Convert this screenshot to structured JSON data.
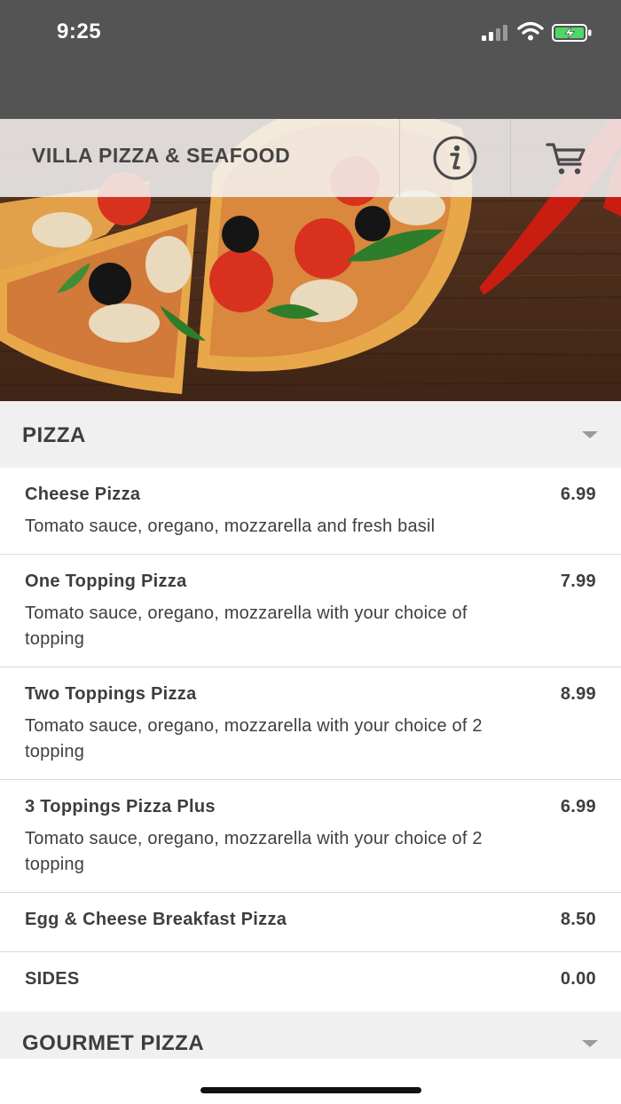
{
  "status_bar": {
    "time": "9:25",
    "icons": [
      "signal-icon",
      "wifi-icon",
      "battery-charging-icon"
    ]
  },
  "header": {
    "restaurant_name": "VILLA PIZZA & SEAFOOD",
    "info_icon": "info-icon",
    "cart_icon": "cart-icon"
  },
  "menu": {
    "categories": [
      {
        "label": "PIZZA",
        "items": [
          {
            "name": "Cheese Pizza",
            "price": "6.99",
            "description": "Tomato sauce, oregano, mozzarella and fresh basil"
          },
          {
            "name": "One Topping Pizza",
            "price": "7.99",
            "description": "Tomato sauce, oregano, mozzarella with your choice of topping"
          },
          {
            "name": "Two Toppings Pizza",
            "price": "8.99",
            "description": "Tomato sauce, oregano, mozzarella with your choice of 2 topping"
          },
          {
            "name": "3 Toppings Pizza Plus",
            "price": "6.99",
            "description": "Tomato sauce, oregano, mozzarella with your choice of 2 topping"
          },
          {
            "name": "Egg & Cheese Breakfast Pizza",
            "price": "8.50"
          },
          {
            "name": "SIDES",
            "price": "0.00"
          }
        ]
      },
      {
        "label": "GOURMET PIZZA",
        "items": []
      }
    ]
  },
  "colors": {
    "status_bar": "#545454",
    "category_background": "#f0f0f0",
    "text": "#3e3e3e",
    "battery_green": "#4cd964"
  }
}
